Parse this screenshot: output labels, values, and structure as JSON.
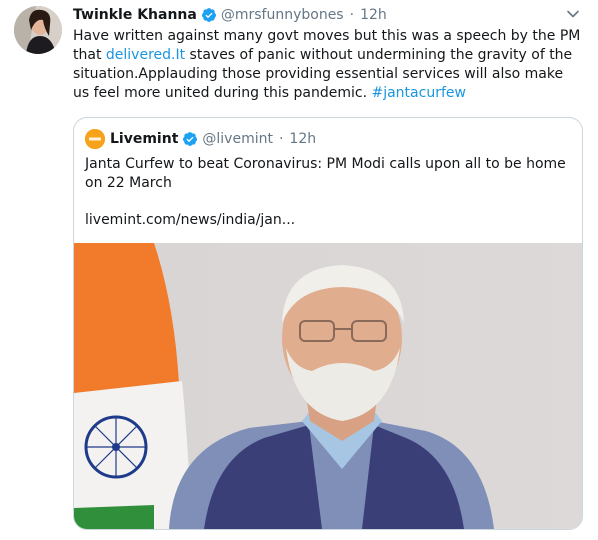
{
  "tweet": {
    "author_name": "Twinkle Khanna",
    "author_handle": "@mrsfunnybones",
    "separator": "·",
    "time": "12h",
    "text_part1": "Have written against many govt moves but this was a speech by the PM that ",
    "text_link": "delivered.It",
    "text_part2": " staves of panic without undermining the gravity of the situation.Applauding those providing essential services will also make us feel more united during this pandemic. ",
    "hashtag": "#jantacurfew"
  },
  "quote": {
    "author_name": "Livemint",
    "author_handle": "@livemint",
    "separator": "·",
    "time": "12h",
    "text": "Janta Curfew to beat Coronavirus: PM Modi calls upon all to be home on 22 March",
    "url": "livemint.com/news/india/jan..."
  },
  "icons": {
    "verified": "verified-badge-icon",
    "caret": "chevron-down-icon"
  },
  "colors": {
    "link": "#1b95e0",
    "secondary_text": "#657786",
    "border": "#ccd6dd",
    "verified": "#1da1f2"
  }
}
